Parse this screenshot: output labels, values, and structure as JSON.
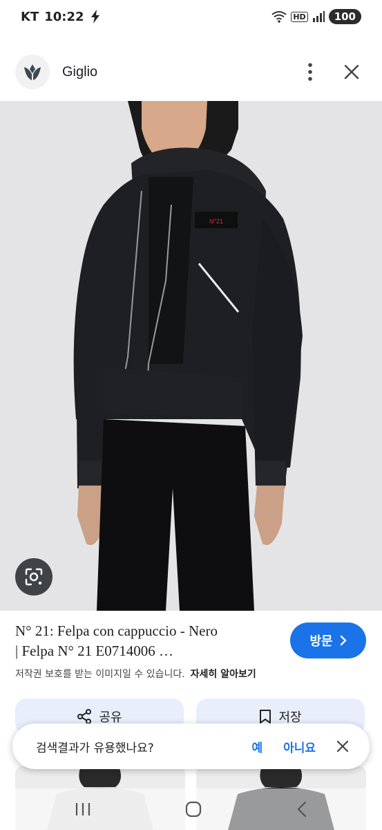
{
  "status_bar": {
    "carrier": "KT",
    "time": "10:22",
    "hd_badge": "HD",
    "battery": "100"
  },
  "site": {
    "name": "Giglio"
  },
  "product": {
    "title_line1": "N° 21: Felpa con cappuccio - Nero",
    "title_line2": "| Felpa N° 21 E0714006 …",
    "visit_label": "방문",
    "copyright_notice": "저작권 보호를 받는 이미지일 수 있습니다.",
    "learn_more": "자세히 알아보기",
    "garment_patch": "N°21"
  },
  "actions": {
    "share_label": "공유",
    "save_label": "저장"
  },
  "feedback": {
    "question": "검색결과가 유용했나요?",
    "yes": "예",
    "no": "아니요"
  },
  "colors": {
    "accent": "#1a73e8",
    "action_bg": "#e8eefb",
    "image_bg": "#e4e4e6",
    "garment": "#1e1f23"
  },
  "icons": [
    "charging-bolt-icon",
    "wifi-icon",
    "signal-icon",
    "more-vert-icon",
    "close-icon",
    "lens-icon",
    "chevron-right-icon",
    "share-icon",
    "bookmark-icon",
    "recents-icon",
    "home-icon",
    "back-icon"
  ]
}
